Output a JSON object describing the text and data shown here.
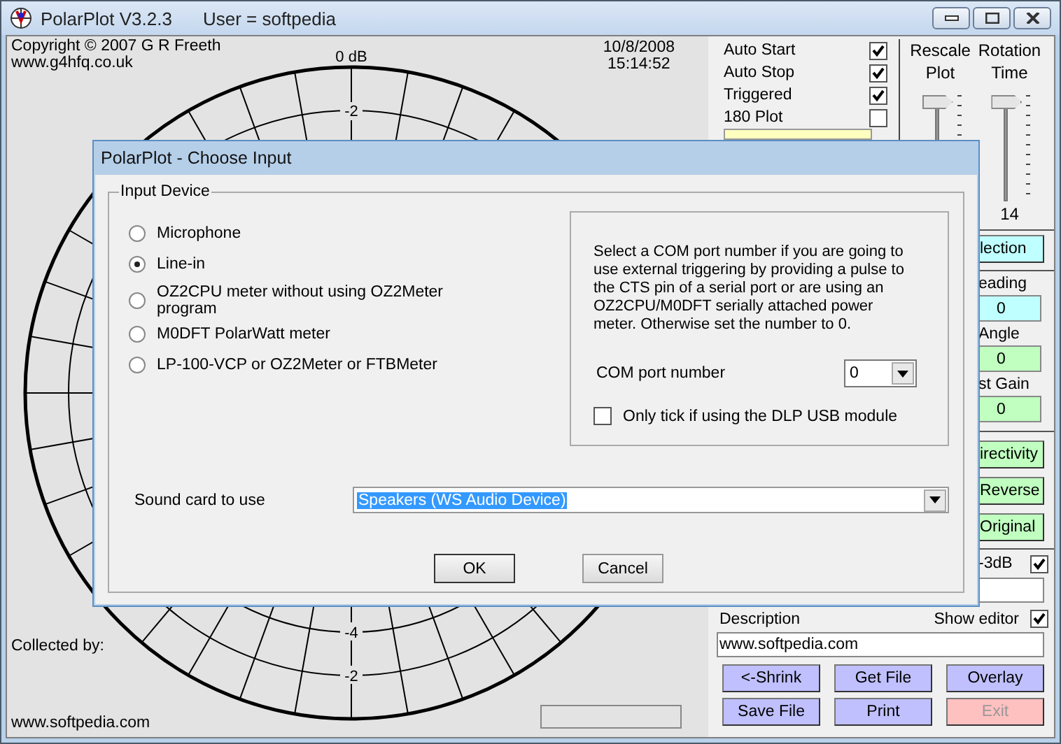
{
  "window": {
    "title": "PolarPlot V3.2.3",
    "user": "User = softpedia"
  },
  "plot": {
    "copyright": "Copyright © 2007 G R Freeth",
    "website": "www.g4hfq.co.uk",
    "date": "10/8/2008",
    "time": "15:14:52",
    "top_labels": [
      "0 dB",
      "-2"
    ],
    "bottom_labels": [
      "-4",
      "-2"
    ],
    "collected_by": "Collected by:",
    "footer_url": "www.softpedia.com"
  },
  "options": [
    {
      "label": "Auto Start",
      "checked": true
    },
    {
      "label": "Auto Stop",
      "checked": true
    },
    {
      "label": "Triggered",
      "checked": true
    },
    {
      "label": "180 Plot",
      "checked": false
    }
  ],
  "sliders": [
    {
      "label": "Rescale Plot",
      "level": 1
    },
    {
      "label": "Rotation Time",
      "level": 1,
      "reading": "14"
    }
  ],
  "selection_button": {
    "label": "lection",
    "color": "#c0ffff"
  },
  "readouts": [
    {
      "label": "eading",
      "value": "0",
      "color": "#c0ffff"
    },
    {
      "label": "Angle",
      "value": "0",
      "color": "#c0ffc0"
    },
    {
      "label": "st Gain",
      "value": "0",
      "color": "#c0ffc0"
    }
  ],
  "side_buttons": [
    {
      "label": "irectivity",
      "color": "#c0ffc0"
    },
    {
      "label": "Reverse",
      "color": "#c0ffc0"
    },
    {
      "label": "Original",
      "color": "#c0ffc0"
    }
  ],
  "minus_3db": {
    "label": "-3dB",
    "checked": true
  },
  "description": {
    "label": "Description",
    "show_editor_label": "Show editor",
    "show_editor": true,
    "value": "www.softpedia.com"
  },
  "buttons": [
    {
      "label": "<-Shrink",
      "disabled": false
    },
    {
      "label": "Get File",
      "disabled": false
    },
    {
      "label": "Overlay",
      "disabled": false
    },
    {
      "label": "Save File",
      "disabled": false
    },
    {
      "label": "Print",
      "disabled": false
    },
    {
      "label": "Exit",
      "disabled": true
    }
  ],
  "dialog": {
    "title": "PolarPlot - Choose Input",
    "group": "Input Device",
    "devices": [
      {
        "label": "Microphone",
        "selected": false
      },
      {
        "label": "Line-in",
        "selected": true
      },
      {
        "label": "OZ2CPU meter without using OZ2Meter program",
        "selected": false
      },
      {
        "label": "M0DFT PolarWatt meter",
        "selected": false
      },
      {
        "label": "LP-100-VCP or OZ2Meter or FTBMeter",
        "selected": false
      }
    ],
    "com_help": "Select a COM port number if you are going to use external triggering by providing a pulse to the CTS pin of a serial port or are using an OZ2CPU/M0DFT serially attached power meter. Otherwise set the number to 0.",
    "com_label": "COM port number",
    "com_value": "0",
    "dlp_label": "Only tick if using the DLP USB module",
    "dlp_checked": false,
    "sound_label": "Sound card to use",
    "sound_value": "Speakers (WS Audio Device)",
    "ok": "OK",
    "cancel": "Cancel"
  }
}
